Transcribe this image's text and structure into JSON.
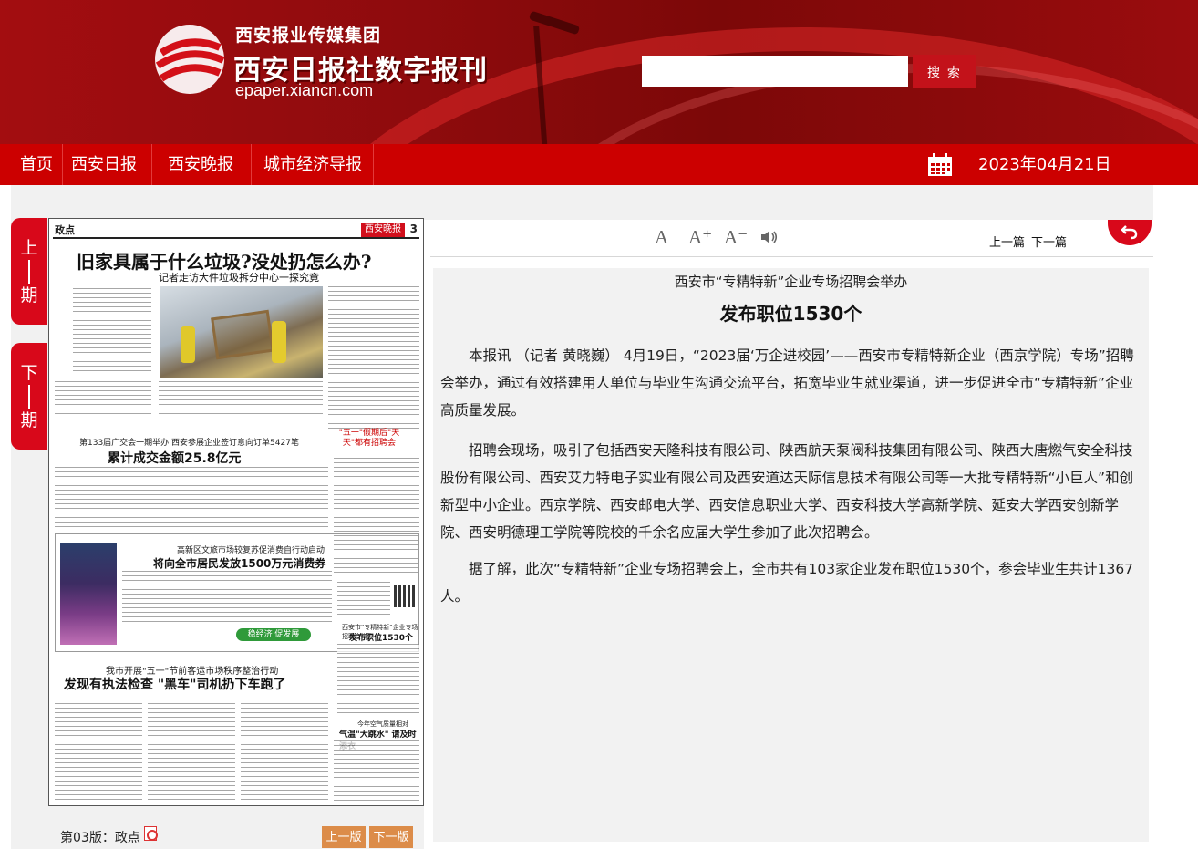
{
  "header": {
    "group_name": "西安报业传媒集团",
    "site_title": "西安日报社数字报刊",
    "domain": "epaper.xiancn.com",
    "search_placeholder": "",
    "search_label": "搜 索"
  },
  "nav": {
    "items": [
      "首页",
      "西安日报",
      "西安晚报",
      "城市经济导报"
    ],
    "date": "2023年04月21日"
  },
  "period": {
    "prev_label": [
      "上",
      "期"
    ],
    "next_label": [
      "下",
      "期"
    ]
  },
  "paper": {
    "section": "政点",
    "page_no": "3",
    "masthead": "西安晚报",
    "headline_main": "旧家具属于什么垃圾?没处扔怎么办?",
    "headline_main_sub": "记者走访大件垃圾拆分中心一探究竟",
    "headline_trade_sub": "第133届广交会一期举办 西安参展企业签订意向订单5427笔",
    "headline_trade": "累计成交金额25.8亿元",
    "headline_wuyi": "\"五一\"假期后\"天天\"都有招聘会",
    "headline_consume_sub": "高新区文旅市场较复苏促消费自行动启动",
    "headline_consume": "将向全市居民发放1500万元消费券",
    "econ_badge": "稳经济 促发展",
    "headline_job_sub": "西安市\"专精特新\"企业专场招聘会举办",
    "headline_job": "发布职位1530个",
    "headline_car_sub": "我市开展\"五一\"节前客运市场秩序整治行动",
    "headline_car": "发现有执法检查 \"黑车\"司机扔下车跑了",
    "headline_weather_sub": "今年空气质量相对",
    "headline_weather": "气温\"大跳水\" 请及时添衣"
  },
  "footer": {
    "edition": "第03版：政点",
    "prev_page": "上一版",
    "next_page": "下一版"
  },
  "toolbar": {
    "font_normal": "A",
    "font_larger": "A⁺",
    "font_smaller": "A⁻",
    "prev_article": "上一篇",
    "next_article": "下一篇"
  },
  "article": {
    "subtitle": "西安市“专精特新”企业专场招聘会举办",
    "title": "发布职位1530个",
    "paragraphs": [
      "本报讯 （记者 黄晓巍） 4月19日，“2023届‘万企进校园’——西安市专精特新企业（西京学院）专场”招聘会举办，通过有效搭建用人单位与毕业生沟通交流平台，拓宽毕业生就业渠道，进一步促进全市“专精特新”企业高质量发展。",
      "招聘会现场，吸引了包括西安天隆科技有限公司、陕西航天泵阀科技集团有限公司、陕西大唐燃气安全科技股份有限公司、西安艾力特电子实业有限公司及西安道达天际信息技术有限公司等一大批专精特新“小巨人”和创新型中小企业。西京学院、西安邮电大学、西安信息职业大学、西安科技大学高新学院、延安大学西安创新学院、西安明德理工学院等院校的千余名应届大学生参加了此次招聘会。",
      "据了解，此次“专精特新”企业专场招聘会上，全市共有103家企业发布职位1530个，参会毕业生共计1367人。"
    ]
  },
  "colors": {
    "banner": "#8e0b0d",
    "nav": "#cc0000",
    "tab": "#d8081a",
    "page_button": "#dc8c49"
  }
}
